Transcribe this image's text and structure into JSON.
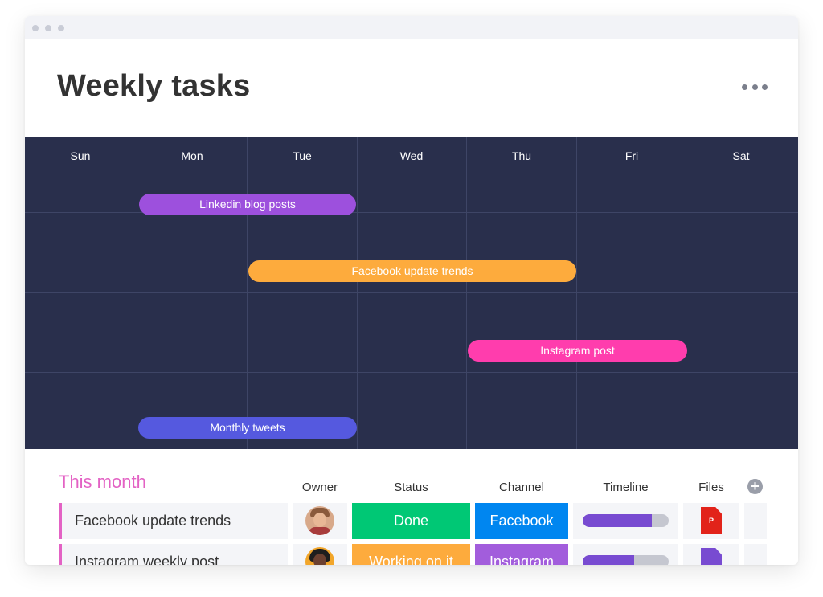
{
  "page": {
    "title": "Weekly tasks",
    "more_icon": "ellipsis-icon"
  },
  "calendar": {
    "days": [
      "Sun",
      "Mon",
      "Tue",
      "Wed",
      "Thu",
      "Fri",
      "Sat"
    ],
    "tasks": [
      {
        "label": "Linkedin blog posts",
        "color": "#9d50dd",
        "start_day": "Mon",
        "end_day": "Tue"
      },
      {
        "label": "Facebook update trends",
        "color": "#fdab3d",
        "start_day": "Tue",
        "end_day": "Thu"
      },
      {
        "label": "Instagram post",
        "color": "#ff3dad",
        "start_day": "Thu",
        "end_day": "Fri"
      },
      {
        "label": "Monthly tweets",
        "color": "#5559df",
        "start_day": "Mon",
        "end_day": "Tue"
      }
    ]
  },
  "table": {
    "section_title": "This month",
    "columns": {
      "owner": "Owner",
      "status": "Status",
      "channel": "Channel",
      "timeline": "Timeline",
      "files": "Files"
    },
    "add_column_icon": "plus-circle-icon",
    "rows": [
      {
        "name": "Facebook update trends",
        "status": "Done",
        "status_color": "#00c875",
        "channel": "Facebook",
        "channel_color": "#0086f0",
        "timeline_progress": 0.8,
        "file_type": "P",
        "file_color": "#e2231a",
        "file_icon": "pdf-file-icon"
      },
      {
        "name": "Instagram weekly post",
        "status": "Working on it",
        "status_color": "#fdab3d",
        "channel": "Instagram",
        "channel_color": "#a25ddc",
        "timeline_progress": 0.6,
        "file_type": "",
        "file_color": "#784bd1",
        "file_icon": "video-file-icon"
      }
    ]
  },
  "colors": {
    "calendar_bg": "#292f4c",
    "accent_pink": "#e362c4"
  }
}
